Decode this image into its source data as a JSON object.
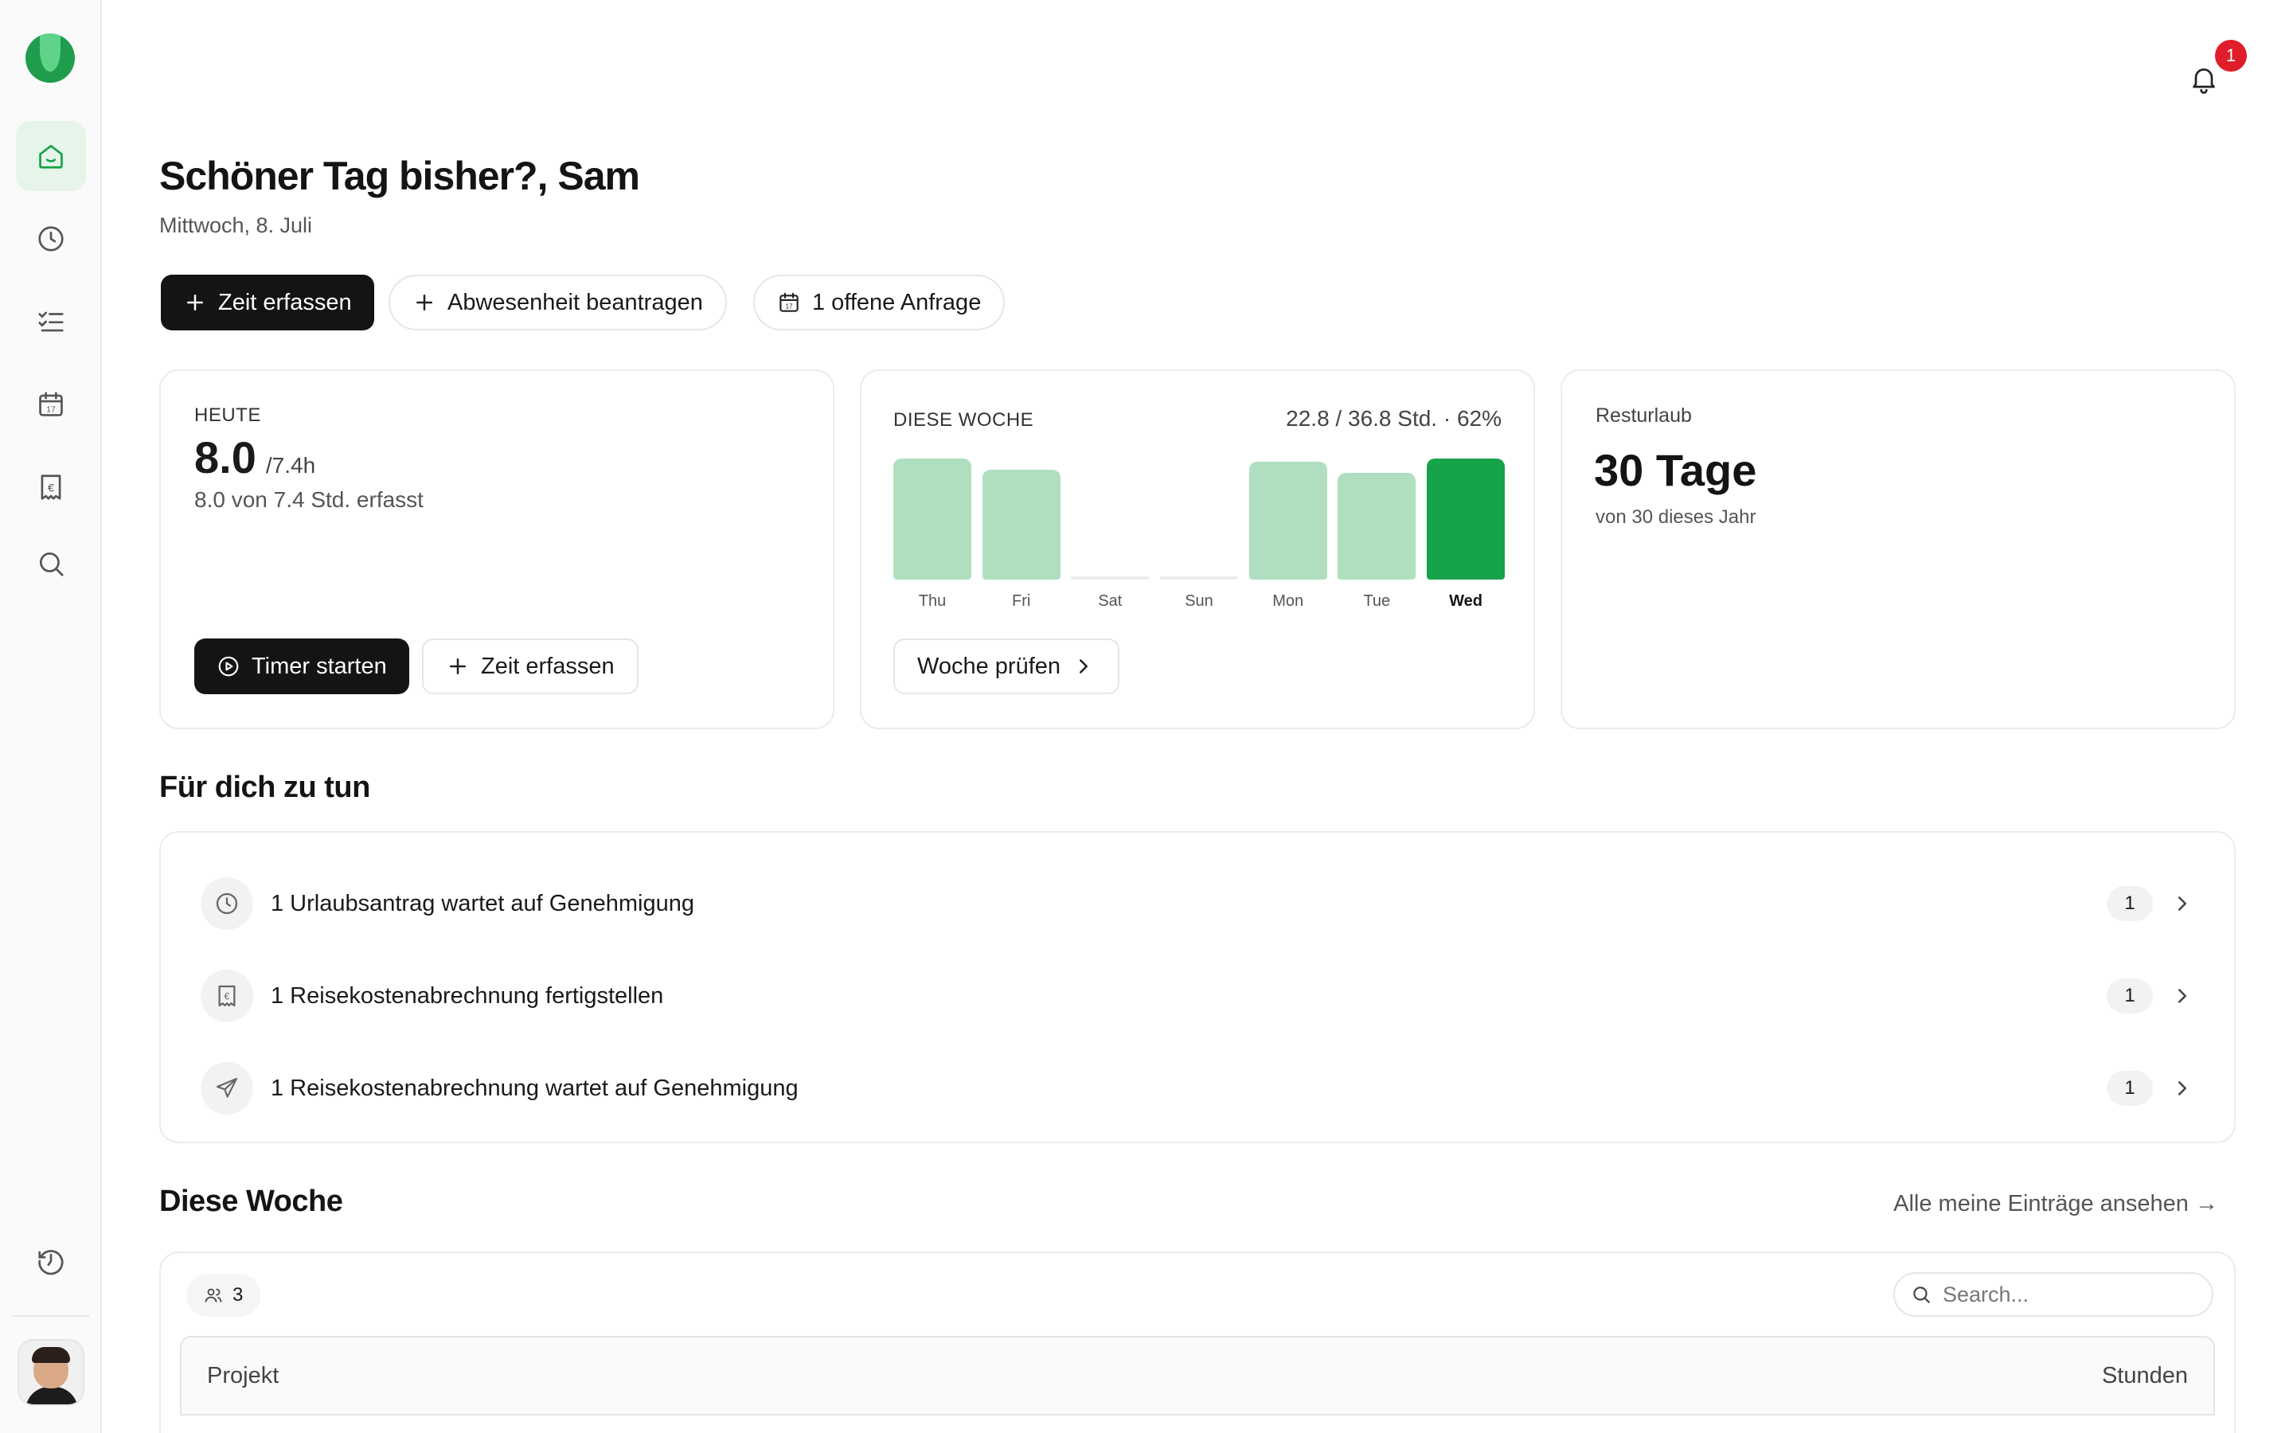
{
  "header": {
    "greeting": "Schöner Tag bisher?, Sam",
    "date": "Mittwoch, 8. Juli",
    "notification_count": "1"
  },
  "actions": {
    "log_time": "Zeit erfassen",
    "request_absence": "Abwesenheit beantragen",
    "open_requests": "1 offene Anfrage"
  },
  "today": {
    "label": "HEUTE",
    "hours": "8.0",
    "target": "/7.4h",
    "summary": "8.0 von 7.4 Std. erfasst",
    "start_timer": "Timer starten",
    "log_time": "Zeit erfassen"
  },
  "week": {
    "label": "DIESE WOCHE",
    "summary": "22.8 / 36.8 Std. · 62%",
    "review_button": "Woche prüfen",
    "chart_data": {
      "type": "bar",
      "categories": [
        "Thu",
        "Fri",
        "Sat",
        "Sun",
        "Mon",
        "Tue",
        "Wed"
      ],
      "values": [
        7.6,
        6.9,
        0,
        0,
        7.4,
        6.7,
        7.6
      ],
      "highlight": "Wed",
      "colors": {
        "bar": "#b0dfc0",
        "highlight": "#16a34a",
        "empty": "#ececec"
      }
    }
  },
  "vacation": {
    "label": "Resturlaub",
    "value": "30 Tage",
    "sub": "von 30 dieses Jahr"
  },
  "todo": {
    "title": "Für dich zu tun",
    "items": [
      {
        "icon": "clock-icon",
        "text": "1 Urlaubsantrag wartet auf Genehmigung",
        "count": "1"
      },
      {
        "icon": "receipt-euro-icon",
        "text": "1 Reisekostenabrechnung fertigstellen",
        "count": "1"
      },
      {
        "icon": "plane-icon",
        "text": "1 Reisekostenabrechnung wartet auf Genehmigung",
        "count": "1"
      }
    ]
  },
  "this_week": {
    "title": "Diese Woche",
    "view_all": "Alle meine Einträge ansehen →",
    "member_count": "3",
    "search_placeholder": "Search...",
    "columns": [
      "Projekt",
      "Stunden"
    ]
  },
  "colors": {
    "accent": "#16a34a",
    "accent_light": "#b0dfc0",
    "badge": "#e01e2b"
  }
}
